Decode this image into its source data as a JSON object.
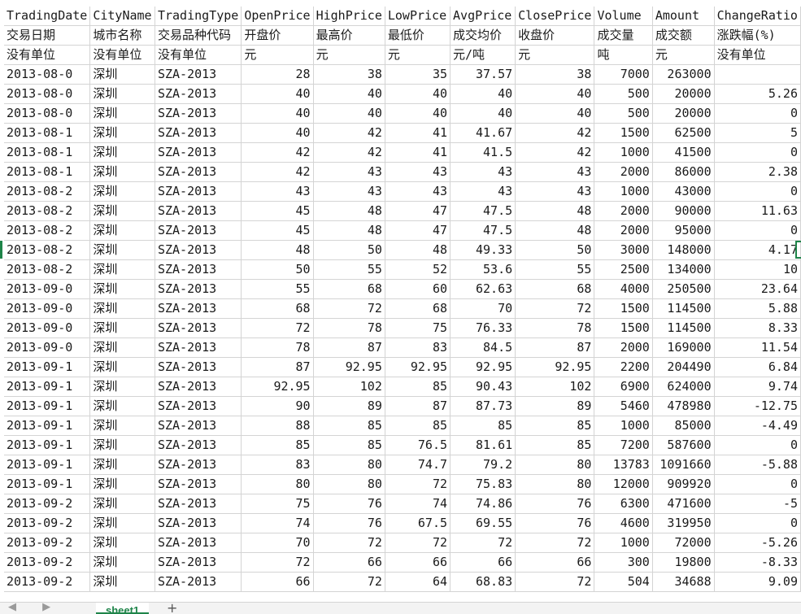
{
  "sheet": {
    "header_row": [
      "TradingDate",
      "CityName",
      "TradingType",
      "OpenPrice",
      "HighPrice",
      "LowPrice",
      "AvgPrice",
      "ClosePrice",
      "Volume",
      "Amount",
      "ChangeRatio"
    ],
    "cn_row": [
      "交易日期",
      "城市名称",
      "交易品种代码",
      "开盘价",
      "最高价",
      "最低价",
      "成交均价",
      "收盘价",
      "成交量",
      "成交额",
      "涨跌幅(%)"
    ],
    "unit_row": [
      "没有单位",
      "没有单位",
      "没有单位",
      "元",
      "元",
      "元",
      "元/吨",
      "元",
      "吨",
      "元",
      "没有单位"
    ],
    "rows": [
      [
        "2013-08-0",
        "深圳",
        "SZA-2013",
        "28",
        "38",
        "35",
        "37.57",
        "38",
        "7000",
        "263000",
        ""
      ],
      [
        "2013-08-0",
        "深圳",
        "SZA-2013",
        "40",
        "40",
        "40",
        "40",
        "40",
        "500",
        "20000",
        "5.26"
      ],
      [
        "2013-08-0",
        "深圳",
        "SZA-2013",
        "40",
        "40",
        "40",
        "40",
        "40",
        "500",
        "20000",
        "0"
      ],
      [
        "2013-08-1",
        "深圳",
        "SZA-2013",
        "40",
        "42",
        "41",
        "41.67",
        "42",
        "1500",
        "62500",
        "5"
      ],
      [
        "2013-08-1",
        "深圳",
        "SZA-2013",
        "42",
        "42",
        "41",
        "41.5",
        "42",
        "1000",
        "41500",
        "0"
      ],
      [
        "2013-08-1",
        "深圳",
        "SZA-2013",
        "42",
        "43",
        "43",
        "43",
        "43",
        "2000",
        "86000",
        "2.38"
      ],
      [
        "2013-08-2",
        "深圳",
        "SZA-2013",
        "43",
        "43",
        "43",
        "43",
        "43",
        "1000",
        "43000",
        "0"
      ],
      [
        "2013-08-2",
        "深圳",
        "SZA-2013",
        "45",
        "48",
        "47",
        "47.5",
        "48",
        "2000",
        "90000",
        "11.63"
      ],
      [
        "2013-08-2",
        "深圳",
        "SZA-2013",
        "45",
        "48",
        "47",
        "47.5",
        "48",
        "2000",
        "95000",
        "0"
      ],
      [
        "2013-08-2",
        "深圳",
        "SZA-2013",
        "48",
        "50",
        "48",
        "49.33",
        "50",
        "3000",
        "148000",
        "4.17"
      ],
      [
        "2013-08-2",
        "深圳",
        "SZA-2013",
        "50",
        "55",
        "52",
        "53.6",
        "55",
        "2500",
        "134000",
        "10"
      ],
      [
        "2013-09-0",
        "深圳",
        "SZA-2013",
        "55",
        "68",
        "60",
        "62.63",
        "68",
        "4000",
        "250500",
        "23.64"
      ],
      [
        "2013-09-0",
        "深圳",
        "SZA-2013",
        "68",
        "72",
        "68",
        "70",
        "72",
        "1500",
        "114500",
        "5.88"
      ],
      [
        "2013-09-0",
        "深圳",
        "SZA-2013",
        "72",
        "78",
        "75",
        "76.33",
        "78",
        "1500",
        "114500",
        "8.33"
      ],
      [
        "2013-09-0",
        "深圳",
        "SZA-2013",
        "78",
        "87",
        "83",
        "84.5",
        "87",
        "2000",
        "169000",
        "11.54"
      ],
      [
        "2013-09-1",
        "深圳",
        "SZA-2013",
        "87",
        "92.95",
        "92.95",
        "92.95",
        "92.95",
        "2200",
        "204490",
        "6.84"
      ],
      [
        "2013-09-1",
        "深圳",
        "SZA-2013",
        "92.95",
        "102",
        "85",
        "90.43",
        "102",
        "6900",
        "624000",
        "9.74"
      ],
      [
        "2013-09-1",
        "深圳",
        "SZA-2013",
        "90",
        "89",
        "87",
        "87.73",
        "89",
        "5460",
        "478980",
        "-12.75"
      ],
      [
        "2013-09-1",
        "深圳",
        "SZA-2013",
        "88",
        "85",
        "85",
        "85",
        "85",
        "1000",
        "85000",
        "-4.49"
      ],
      [
        "2013-09-1",
        "深圳",
        "SZA-2013",
        "85",
        "85",
        "76.5",
        "81.61",
        "85",
        "7200",
        "587600",
        "0"
      ],
      [
        "2013-09-1",
        "深圳",
        "SZA-2013",
        "83",
        "80",
        "74.7",
        "79.2",
        "80",
        "13783",
        "1091660",
        "-5.88"
      ],
      [
        "2013-09-1",
        "深圳",
        "SZA-2013",
        "80",
        "80",
        "72",
        "75.83",
        "80",
        "12000",
        "909920",
        "0"
      ],
      [
        "2013-09-2",
        "深圳",
        "SZA-2013",
        "75",
        "76",
        "74",
        "74.86",
        "76",
        "6300",
        "471600",
        "-5"
      ],
      [
        "2013-09-2",
        "深圳",
        "SZA-2013",
        "74",
        "76",
        "67.5",
        "69.55",
        "76",
        "4600",
        "319950",
        "0"
      ],
      [
        "2013-09-2",
        "深圳",
        "SZA-2013",
        "70",
        "72",
        "72",
        "72",
        "72",
        "1000",
        "72000",
        "-5.26"
      ],
      [
        "2013-09-2",
        "深圳",
        "SZA-2013",
        "72",
        "66",
        "66",
        "66",
        "66",
        "300",
        "19800",
        "-8.33"
      ],
      [
        "2013-09-2",
        "深圳",
        "SZA-2013",
        "66",
        "72",
        "64",
        "68.83",
        "72",
        "504",
        "34688",
        "9.09"
      ]
    ],
    "numeric_columns": [
      3,
      4,
      5,
      6,
      7,
      8,
      9,
      10
    ]
  },
  "tabs": {
    "active_label": "sheet1",
    "add_label": "+",
    "nav_arrows": "◀ ▶"
  },
  "colors": {
    "accent": "#1e8449",
    "gridline": "#d4d4d4"
  }
}
